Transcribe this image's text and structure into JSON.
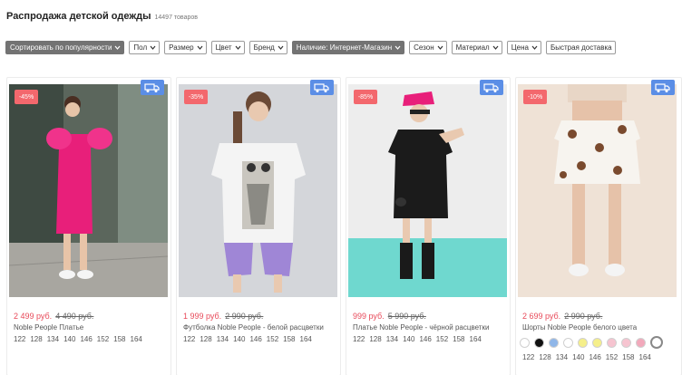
{
  "header": {
    "title": "Распродажа детской одежды",
    "count": "14497 товаров"
  },
  "filters": [
    {
      "label": "Сортировать по популярности",
      "dark": true
    },
    {
      "label": "Пол",
      "dark": false
    },
    {
      "label": "Размер",
      "dark": false
    },
    {
      "label": "Цвет",
      "dark": false
    },
    {
      "label": "Бренд",
      "dark": false
    },
    {
      "label": "Наличие: Интернет-Магазин",
      "dark": true
    },
    {
      "label": "Сезон",
      "dark": false
    },
    {
      "label": "Материал",
      "dark": false
    },
    {
      "label": "Цена",
      "dark": false
    },
    {
      "label": "Быстрая доставка",
      "dark": false,
      "no_chevron": true
    }
  ],
  "products": [
    {
      "discount": "-45%",
      "price": "2 499 руб.",
      "old_price": "4 490 руб.",
      "name": "Noble People Платье",
      "sizes": [
        "122",
        "128",
        "134",
        "140",
        "146",
        "152",
        "158",
        "164"
      ],
      "icon": "delivery-truck-icon"
    },
    {
      "discount": "-35%",
      "price": "1 999 руб.",
      "old_price": "2 990 руб.",
      "name": "Футболка Noble People - белой расцветки",
      "sizes": [
        "122",
        "128",
        "134",
        "140",
        "146",
        "152",
        "158",
        "164"
      ],
      "icon": "delivery-truck-icon"
    },
    {
      "discount": "-85%",
      "price": "999 руб.",
      "old_price": "5 990 руб.",
      "name": "Платье Noble People - чёрной расцветки",
      "sizes": [
        "122",
        "128",
        "134",
        "140",
        "146",
        "152",
        "158",
        "164"
      ],
      "icon": "delivery-truck-icon"
    },
    {
      "discount": "-10%",
      "price": "2 699 руб.",
      "old_price": "2 990 руб.",
      "name": "Шорты Noble People белого цвета",
      "sizes": [
        "122",
        "128",
        "134",
        "140",
        "146",
        "152",
        "158",
        "164"
      ],
      "icon": "delivery-truck-icon",
      "swatches": [
        "#ffffff",
        "#111111",
        "#8fb6e8",
        "#ffffff",
        "#f5ef8a",
        "#f5ef8a",
        "#f6c4d0",
        "#f6c4d0",
        "#f2a9bb"
      ]
    }
  ],
  "colors": {
    "accent": "#5b8ee6",
    "sale": "#f3686d",
    "price": "#e84a5a"
  }
}
